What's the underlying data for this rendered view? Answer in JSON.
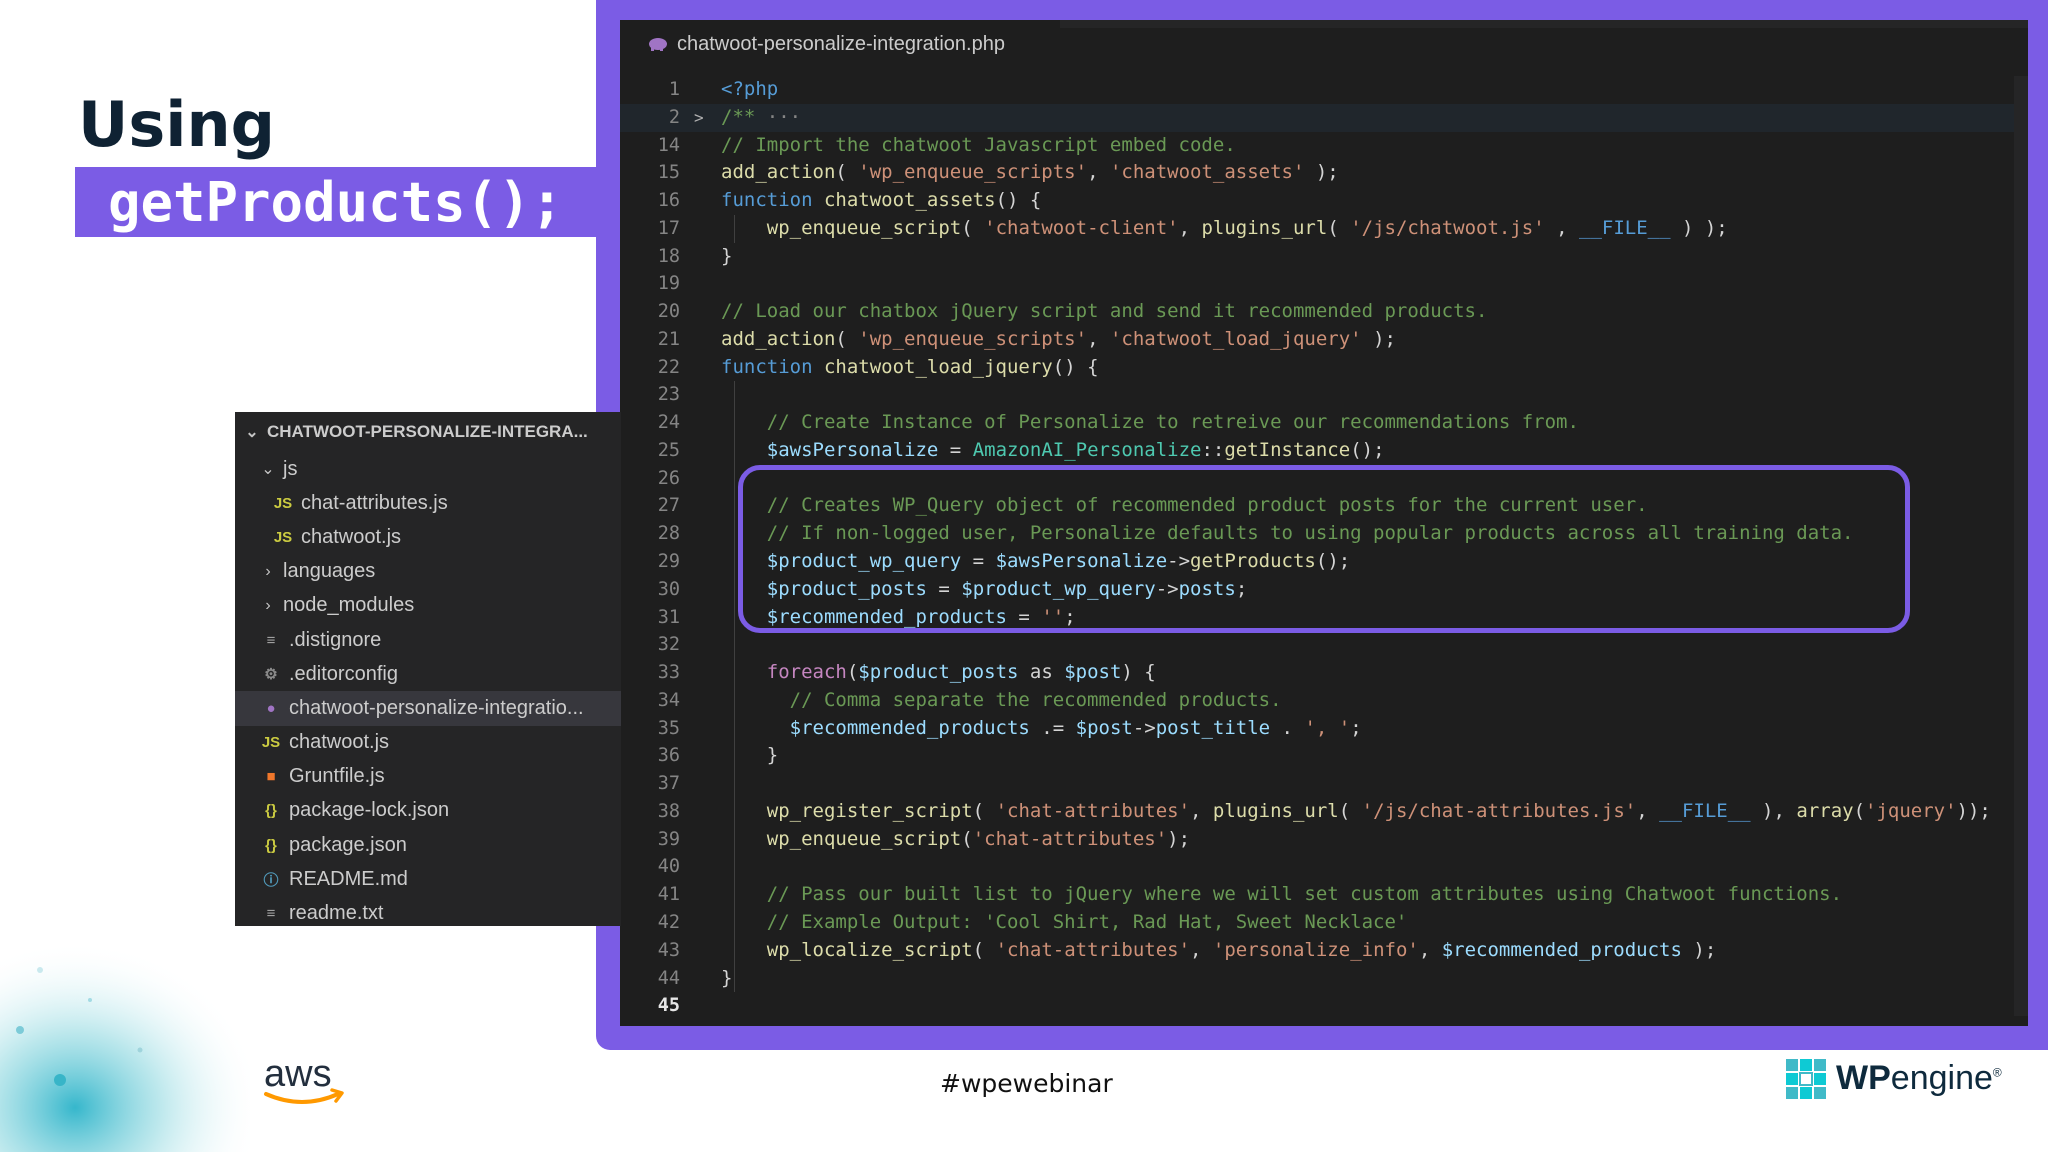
{
  "slide": {
    "title": "Using",
    "code_title": "getProducts();",
    "hashtag": "#wpewebinar"
  },
  "editor": {
    "tab_title": "chatwoot-personalize-integration.php",
    "lines": [
      {
        "n": "1",
        "html": "<span class=\"k\">&lt;?php</span>"
      },
      {
        "n": "2",
        "html": "<span class=\"c\">/** </span><span style=\"color:#858585\">···</span>",
        "fold": "&gt;",
        "current": true
      },
      {
        "n": "14",
        "html": "<span class=\"c\">// Import the chatwoot Javascript embed code.</span>"
      },
      {
        "n": "15",
        "html": "<span class=\"f\">add_action</span>( <span class=\"s\">'wp_enqueue_scripts'</span>, <span class=\"s\">'chatwoot_assets'</span> );"
      },
      {
        "n": "16",
        "html": "<span class=\"k\">function</span> <span class=\"f\">chatwoot_assets</span>() {"
      },
      {
        "n": "17",
        "html": "    <span class=\"f\">wp_enqueue_script</span>( <span class=\"s\">'chatwoot-client'</span>, <span class=\"f\">plugins_url</span>( <span class=\"s\">'/js/chatwoot.js'</span> , <span class=\"k\">__FILE__</span> ) );"
      },
      {
        "n": "18",
        "html": "}"
      },
      {
        "n": "19",
        "html": ""
      },
      {
        "n": "20",
        "html": "<span class=\"c\">// Load our chatbox jQuery script and send it recommended products.</span>"
      },
      {
        "n": "21",
        "html": "<span class=\"f\">add_action</span>( <span class=\"s\">'wp_enqueue_scripts'</span>, <span class=\"s\">'chatwoot_load_jquery'</span> );"
      },
      {
        "n": "22",
        "html": "<span class=\"k\">function</span> <span class=\"f\">chatwoot_load_jquery</span>() {"
      },
      {
        "n": "23",
        "html": ""
      },
      {
        "n": "24",
        "html": "    <span class=\"c\">// Create Instance of Personalize to retreive our recommendations from.</span>"
      },
      {
        "n": "25",
        "html": "    <span class=\"v\">$awsPersonalize</span> = <span class=\"t\">AmazonAI_Personalize</span>::<span class=\"f\">getInstance</span>();"
      },
      {
        "n": "26",
        "html": ""
      },
      {
        "n": "27",
        "html": "    <span class=\"c\">// Creates WP_Query object of recommended product posts for the current user.</span>"
      },
      {
        "n": "28",
        "html": "    <span class=\"c\">// If non-logged user, Personalize defaults to using popular products across all training data.</span>"
      },
      {
        "n": "29",
        "html": "    <span class=\"v\">$product_wp_query</span> = <span class=\"v\">$awsPersonalize</span>-&gt;<span class=\"f\">getProducts</span>();"
      },
      {
        "n": "30",
        "html": "    <span class=\"v\">$product_posts</span> = <span class=\"v\">$product_wp_query</span>-&gt;<span class=\"v\">posts</span>;"
      },
      {
        "n": "31",
        "html": "    <span class=\"v\">$recommended_products</span> = <span class=\"s\">''</span>;"
      },
      {
        "n": "32",
        "html": ""
      },
      {
        "n": "33",
        "html": "    <span class=\"p\">foreach</span>(<span class=\"v\">$product_posts</span> as <span class=\"v\">$post</span>) {"
      },
      {
        "n": "34",
        "html": "      <span class=\"c\">// Comma separate the recommended products.</span>"
      },
      {
        "n": "35",
        "html": "      <span class=\"v\">$recommended_products</span> .= <span class=\"v\">$post</span>-&gt;<span class=\"v\">post_title</span> . <span class=\"s\">', '</span>;"
      },
      {
        "n": "36",
        "html": "    }"
      },
      {
        "n": "37",
        "html": ""
      },
      {
        "n": "38",
        "html": "    <span class=\"f\">wp_register_script</span>( <span class=\"s\">'chat-attributes'</span>, <span class=\"f\">plugins_url</span>( <span class=\"s\">'/js/chat-attributes.js'</span>, <span class=\"k\">__FILE__</span> ), <span class=\"f\">array</span>(<span class=\"s\">'jquery'</span>));"
      },
      {
        "n": "39",
        "html": "    <span class=\"f\">wp_enqueue_script</span>(<span class=\"s\">'chat-attributes'</span>);"
      },
      {
        "n": "40",
        "html": ""
      },
      {
        "n": "41",
        "html": "    <span class=\"c\">// Pass our built list to jQuery where we will set custom attributes using Chatwoot functions.</span>"
      },
      {
        "n": "42",
        "html": "    <span class=\"c\">// Example Output: 'Cool Shirt, Rad Hat, Sweet Necklace'</span>"
      },
      {
        "n": "43",
        "html": "    <span class=\"f\">wp_localize_script</span>( <span class=\"s\">'chat-attributes'</span>, <span class=\"s\">'personalize_info'</span>, <span class=\"v\">$recommended_products</span> );"
      },
      {
        "n": "44",
        "html": "}"
      },
      {
        "n": "45",
        "html": "",
        "active": true
      }
    ]
  },
  "explorer": {
    "root": "CHATWOOT-PERSONALIZE-INTEGRA...",
    "items": [
      {
        "label": "js",
        "kind": "folder-open",
        "depth": 1
      },
      {
        "label": "chat-attributes.js",
        "kind": "js",
        "depth": 2
      },
      {
        "label": "chatwoot.js",
        "kind": "js",
        "depth": 2
      },
      {
        "label": "languages",
        "kind": "folder",
        "depth": 1
      },
      {
        "label": "node_modules",
        "kind": "folder",
        "depth": 1
      },
      {
        "label": ".distignore",
        "kind": "lines",
        "depth": 1
      },
      {
        "label": ".editorconfig",
        "kind": "gear",
        "depth": 1
      },
      {
        "label": "chatwoot-personalize-integratio...",
        "kind": "php",
        "depth": 1,
        "selected": true
      },
      {
        "label": "chatwoot.js",
        "kind": "js",
        "depth": 1
      },
      {
        "label": "Gruntfile.js",
        "kind": "grunt",
        "depth": 1
      },
      {
        "label": "package-lock.json",
        "kind": "json",
        "depth": 1
      },
      {
        "label": "package.json",
        "kind": "json",
        "depth": 1
      },
      {
        "label": "README.md",
        "kind": "info",
        "depth": 1
      },
      {
        "label": "readme.txt",
        "kind": "lines",
        "depth": 1
      }
    ]
  },
  "logos": {
    "aws": "aws",
    "wpengine_bold": "WP",
    "wpengine_light": "engine"
  },
  "colors": {
    "accent_purple": "#7b5ce5",
    "title_dark": "#0f2233",
    "editor_bg": "#1e1e1e",
    "explorer_bg": "#252526"
  }
}
